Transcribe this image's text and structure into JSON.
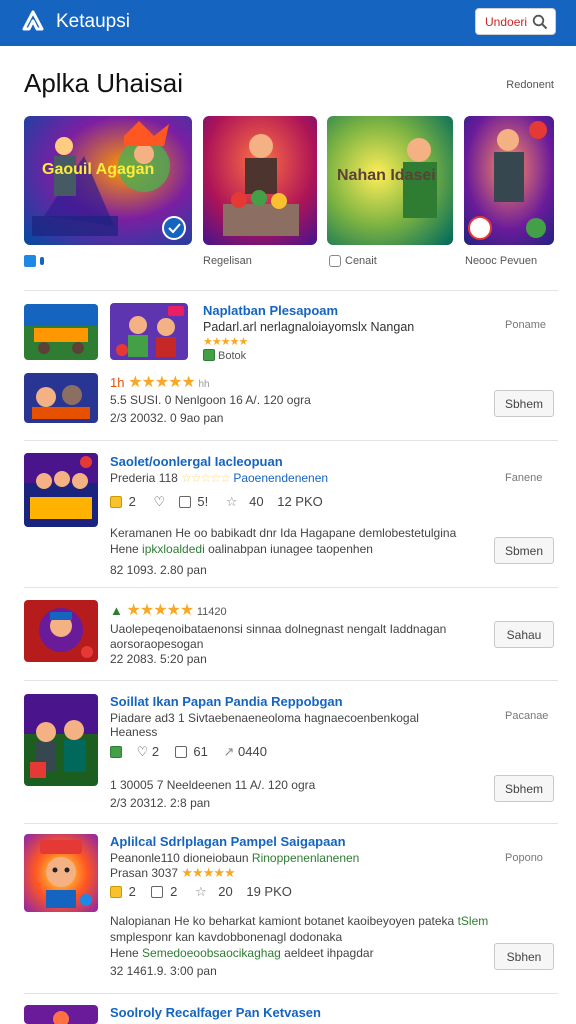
{
  "header": {
    "app_title": "Ketaupsi",
    "top_button": "Undoeri"
  },
  "page": {
    "title": "Aplka Uhaisai",
    "side_link": "Redonent"
  },
  "heroes": [
    {
      "caption": "",
      "art": "Gaouil Agagan"
    },
    {
      "caption": "Regelisan",
      "art": ""
    },
    {
      "caption": "Cenait",
      "art": "Nahan Idasei"
    },
    {
      "caption": "Neooc Pevuen",
      "art": ""
    }
  ],
  "item1": {
    "title": "Naplatban Plesapoam",
    "sub": "Padarl.arl nerlagnaloiayomslx Nangan",
    "badge": "Botok",
    "side": "Poname",
    "rating_text": "1h",
    "rating_suffix": "hh",
    "meta": "5.5 SUSI.  0  Nenlgoon 16 A/.  120 ogra",
    "date": "2/3 20032. 0  9ao pan",
    "button": "Sbhem"
  },
  "item2": {
    "title": "Saolet/oonlergal Iacleopuan",
    "sub": "Prederia 118",
    "sub2": "Paoenendenenen",
    "side": "Fanene",
    "meta_a": "2",
    "meta_b": "5!",
    "meta_c": "40",
    "meta_d": "12 PKO",
    "desc1": "Keramanen He oo babikadt dnr Ida Hagapane demlobestetulgina",
    "desc2": "Hene",
    "desc2_green": "ipkxloaldedi",
    "desc2_rest": "oalinabpan iunagee taopenhen",
    "date": "82 1093.  2.80 pan",
    "button": "Sbmen"
  },
  "item3": {
    "rating_text": "11420",
    "desc1": "Uaolepeqenoibataenonsi sinnaa dolnegnast nengalt Iaddnagan",
    "desc2": "aorsoraopesogan",
    "date": "22 2083. 5:20 pan",
    "button": "Sahau"
  },
  "item4": {
    "title": "Soillat Ikan Papan Pandia Reppobgan",
    "sub": "Piadare ad3 1 Sivtaebenaeneoloma hagnaecoenbenkogal",
    "sub2": "Heaness",
    "side": "Pacanae",
    "meta_a": "2",
    "meta_b": "61",
    "meta_c": "0440",
    "meta": "1 30005  7 Neeldeenen 11 A/.  120 ogra",
    "date": "2/3 20312. 2:8 pan",
    "button": "Sbhem"
  },
  "item5": {
    "title": "Aplilcal Sdrlplagan Pampel Saigapaan",
    "sub": "Peanonle110 dioneiobaun",
    "sub_green": "Rinoppenenlanenen",
    "sub2": "Prasan 3037",
    "side": "Popono",
    "meta_a": "2",
    "meta_b": "2",
    "meta_c": "20",
    "meta_d": "19 PKO",
    "desc1": "Nalopianan He ko beharkat kamiont botanet kaoibeyoyen pateka",
    "desc1_green": "tSlem",
    "desc2": "smplesponr kan kavdobbonenagl dodonaka",
    "desc3": "Hene",
    "desc3_green": "Semedoeoobsaocikaghag",
    "desc3_rest": "aeldeet ihpagdar",
    "date": "32 1461.9. 3:00 pan",
    "button": "Sbhen"
  },
  "item6": {
    "title": "Soolroly Recalfager Pan Ketvasen"
  },
  "colors": {
    "header_bg": "#1565c0",
    "link_blue": "#1565c0",
    "star": "#f9a825",
    "green": "#2e7d32"
  }
}
